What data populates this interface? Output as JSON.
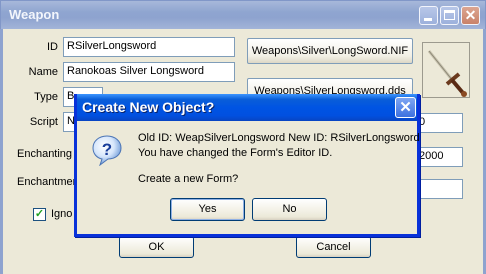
{
  "weapon_window": {
    "title": "Weapon",
    "fields": {
      "id": {
        "label": "ID",
        "value": "RSilverLongsword"
      },
      "name": {
        "label": "Name",
        "value": "Ranokoas Silver Longsword"
      },
      "type": {
        "label": "Type",
        "value": "B"
      },
      "script": {
        "label": "Script",
        "value": "N"
      },
      "enchanting": {
        "label": "Enchanting",
        "value": "2000"
      },
      "enchantment": {
        "label": "Enchantmer",
        "value": ""
      },
      "right_field_1": {
        "value": "0"
      }
    },
    "model_path_button": "Weapons\\Silver\\LongSword.NIF",
    "icon_path_button": "Weapons\\SilverLongsword.dds",
    "ignore_checkbox": {
      "label": "Igno",
      "checked": true
    },
    "ok_button": "OK",
    "cancel_button": "Cancel"
  },
  "dialog": {
    "title": "Create New Object?",
    "line1": "Old ID: WeapSilverLongsword New ID: RSilverLongsword",
    "line2": "You have changed the Form's Editor ID.",
    "line3": "Create a new Form?",
    "yes_button": "Yes",
    "no_button": "No",
    "icon": "question-icon"
  },
  "colors": {
    "dialog_titlebar": "#0054e3",
    "inactive_titlebar": "#8ea3cf",
    "window_background": "#ece9d8"
  }
}
